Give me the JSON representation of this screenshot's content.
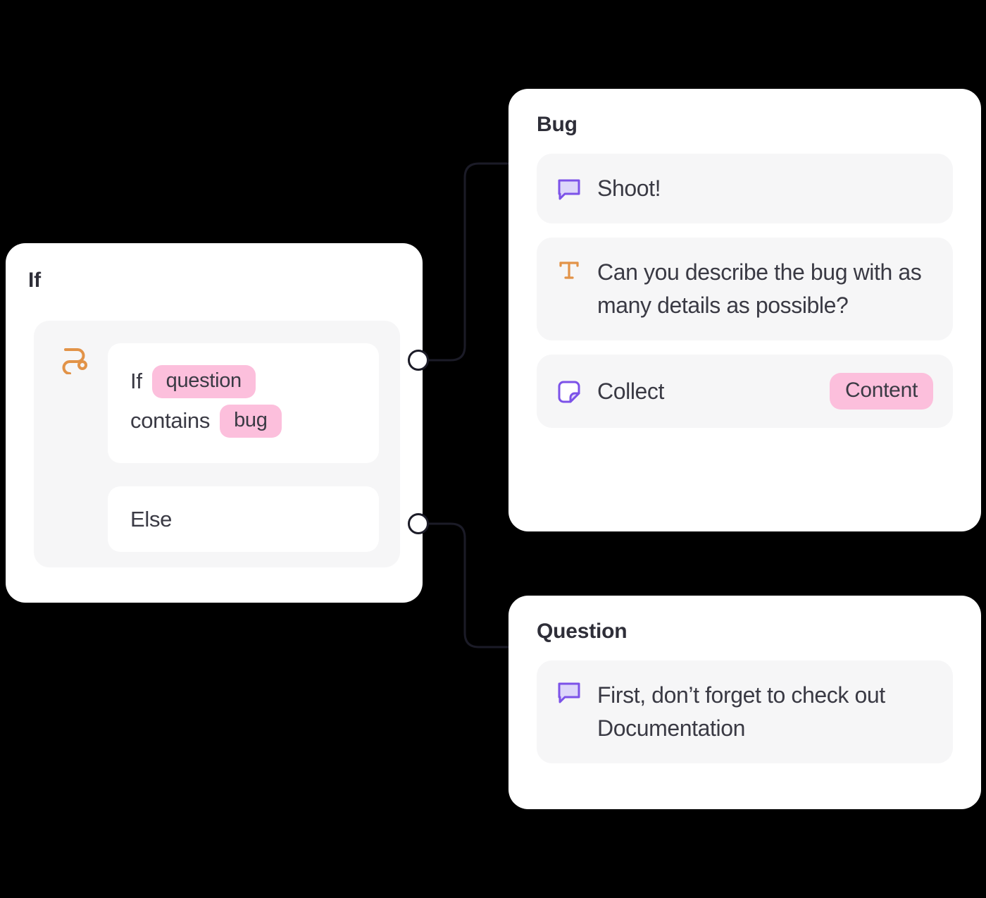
{
  "canvas": {
    "background": "#000000",
    "accent_pink": "#fcbfdc",
    "accent_purple": "#7c52e8",
    "accent_orange": "#e29348",
    "edge_color": "#1b1b27"
  },
  "nodes": {
    "if_node": {
      "title": "If",
      "branch_icon": "route-branch-icon",
      "condition": {
        "keyword": "If",
        "variable": "question",
        "operator": "contains",
        "value": "bug"
      },
      "else_label": "Else",
      "ports": [
        {
          "name": "true-output-port",
          "label": "true"
        },
        {
          "name": "false-output-port",
          "label": "false"
        }
      ]
    },
    "bug_node": {
      "title": "Bug",
      "rows": [
        {
          "icon": "speech-bubble-icon",
          "text": "Shoot!",
          "badge": null
        },
        {
          "icon": "text-format-icon",
          "text": "Can you describe the bug with as many details as possible?",
          "badge": null
        },
        {
          "icon": "sticker-note-icon",
          "text": "Collect",
          "badge": "Content"
        }
      ]
    },
    "question_node": {
      "title": "Question",
      "rows": [
        {
          "icon": "speech-bubble-icon",
          "text": "First, don’t forget to check out Documentation",
          "badge": null
        }
      ]
    }
  }
}
